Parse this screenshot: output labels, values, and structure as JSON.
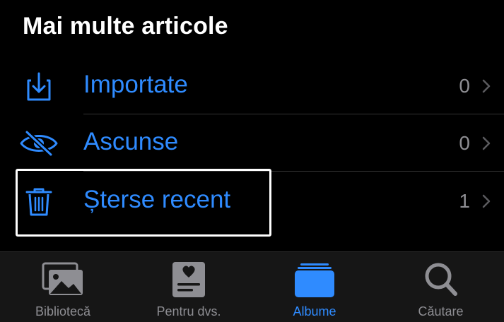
{
  "section": {
    "title": "Mai multe articole"
  },
  "rows": [
    {
      "label": "Importate",
      "count": "0",
      "icon": "import-icon"
    },
    {
      "label": "Ascunse",
      "count": "0",
      "icon": "eye-slash-icon"
    },
    {
      "label": "Șterse recent",
      "count": "1",
      "icon": "trash-icon"
    }
  ],
  "tabs": [
    {
      "label": "Bibliotecă",
      "icon": "photos-library-icon",
      "active": false
    },
    {
      "label": "Pentru dvs.",
      "icon": "for-you-icon",
      "active": false
    },
    {
      "label": "Albume",
      "icon": "albums-icon",
      "active": true
    },
    {
      "label": "Căutare",
      "icon": "search-icon",
      "active": false
    }
  ],
  "colors": {
    "accent": "#2f8bff",
    "secondary_text": "#8e8e93",
    "background": "#000000",
    "tabbar_bg": "#161616",
    "inactive_icon": "#8e8e93"
  }
}
